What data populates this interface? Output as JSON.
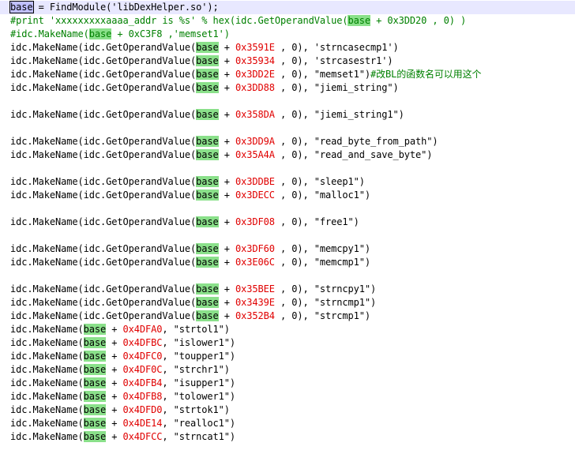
{
  "editor": {
    "lines": [
      {
        "type": "assign",
        "base": "base",
        "rest1": " = FindModule(",
        "str": "'libDexHelper.so'",
        "rest2": ");"
      },
      {
        "type": "comment",
        "text": "#print 'xxxxxxxxxaaaa_addr is %s' % hex(idc.GetOperandValue(",
        "base": "base",
        "text2": " + 0x3DD20 , 0) )"
      },
      {
        "type": "comment",
        "text": "#idc.MakeName(",
        "base": "base",
        "text2": " + 0xC3F8 ,'memset1')"
      },
      {
        "type": "gov",
        "base": "base",
        "offset": "0x3591E",
        "str": "'strncasecmp1'"
      },
      {
        "type": "gov",
        "base": "base",
        "offset": "0x35934",
        "str": "'strcasestr1'"
      },
      {
        "type": "gov",
        "base": "base",
        "offset": "0x3DD2E",
        "str": "\"memset1\"",
        "tail": "#改BL的函数名可以用这个"
      },
      {
        "type": "gov",
        "base": "base",
        "offset": "0x3DD88",
        "str": "\"jiemi_string\""
      },
      {
        "type": "blank"
      },
      {
        "type": "gov",
        "base": "base",
        "offset": "0x358DA",
        "str": "\"jiemi_string1\""
      },
      {
        "type": "blank"
      },
      {
        "type": "gov",
        "base": "base",
        "offset": "0x3DD9A",
        "str": "\"read_byte_from_path\""
      },
      {
        "type": "gov",
        "base": "base",
        "offset": "0x35A4A",
        "str": "\"read_and_save_byte\""
      },
      {
        "type": "blank"
      },
      {
        "type": "gov",
        "base": "base",
        "offset": "0x3DDBE",
        "str": "\"sleep1\""
      },
      {
        "type": "gov",
        "base": "base",
        "offset": "0x3DECC",
        "str": "\"malloc1\""
      },
      {
        "type": "blank"
      },
      {
        "type": "gov",
        "base": "base",
        "offset": "0x3DF08",
        "str": "\"free1\""
      },
      {
        "type": "blank"
      },
      {
        "type": "gov",
        "base": "base",
        "offset": "0x3DF60",
        "str": "\"memcpy1\""
      },
      {
        "type": "gov",
        "base": "base",
        "offset": "0x3E06C",
        "str": "\"memcmp1\""
      },
      {
        "type": "blank"
      },
      {
        "type": "gov",
        "base": "base",
        "offset": "0x35BEE",
        "str": "\"strncpy1\""
      },
      {
        "type": "gov",
        "base": "base",
        "offset": "0x3439E",
        "str": "\"strncmp1\""
      },
      {
        "type": "gov",
        "base": "base",
        "offset": "0x352B4",
        "str": "\"strcmp1\""
      },
      {
        "type": "mk",
        "base": "base",
        "offset": "0x4DFA0",
        "str": "\"strtol1\""
      },
      {
        "type": "mk",
        "base": "base",
        "offset": "0x4DFBC",
        "str": "\"islower1\""
      },
      {
        "type": "mk",
        "base": "base",
        "offset": "0x4DFC0",
        "str": "\"toupper1\""
      },
      {
        "type": "mk",
        "base": "base",
        "offset": "0x4DF0C",
        "str": "\"strchr1\""
      },
      {
        "type": "mk",
        "base": "base",
        "offset": "0x4DFB4",
        "str": "\"isupper1\""
      },
      {
        "type": "mk",
        "base": "base",
        "offset": "0x4DFB8",
        "str": "\"tolower1\""
      },
      {
        "type": "mk",
        "base": "base",
        "offset": "0x4DFD0",
        "str": "\"strtok1\""
      },
      {
        "type": "mk",
        "base": "base",
        "offset": "0x4DE14",
        "str": "\"realloc1\""
      },
      {
        "type": "mk",
        "base": "base",
        "offset": "0x4DFCC",
        "str": "\"strncat1\""
      }
    ],
    "fragments": {
      "gov_prefix": "idc.MakeName(idc.GetOperandValue(",
      "plus": " + ",
      "mid": " , 0), ",
      "end": ")",
      "mk_prefix": "idc.MakeName(",
      "mk_mid": ", "
    },
    "colors": {
      "highlight": "#8ae08a",
      "number": "#e00000",
      "comment": "#008000"
    }
  }
}
